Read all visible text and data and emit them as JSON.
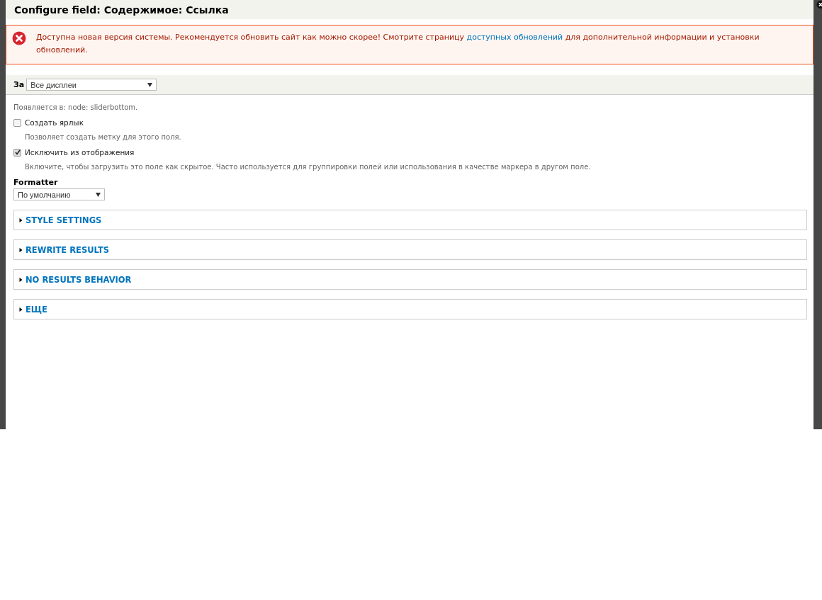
{
  "dialog": {
    "title": "Configure field: Содержимое: Ссылка"
  },
  "message": {
    "kind": "error",
    "before": "Доступна новая версия системы. Рекомендуется обновить сайт как можно скорее! Смотрите страницу ",
    "link": "доступных обновлений",
    "after": " для дополнительной информации и установки обновлений."
  },
  "display_select": {
    "label": "За",
    "value": "Все дисплеи"
  },
  "appears_in": "Появляется в: node: sliderbottom.",
  "checkboxes": [
    {
      "label": "Создать ярлык",
      "checked": false,
      "description": "Позволяет создать метку для этого поля."
    },
    {
      "label": "Исключить из отображения",
      "checked": true,
      "description": "Включите, чтобы загрузить это поле как скрытое. Часто используется для группировки полей или использования в качестве маркера в другом поле."
    }
  ],
  "formatter": {
    "label": "Formatter",
    "value": "По умолчанию"
  },
  "fieldsets": [
    {
      "title": "STYLE SETTINGS",
      "expanded": false
    },
    {
      "title": "REWRITE RESULTS",
      "expanded": false
    },
    {
      "title": "NO RESULTS BEHAVIOR",
      "expanded": false
    },
    {
      "title": "ЕЩЕ",
      "expanded": false
    }
  ]
}
